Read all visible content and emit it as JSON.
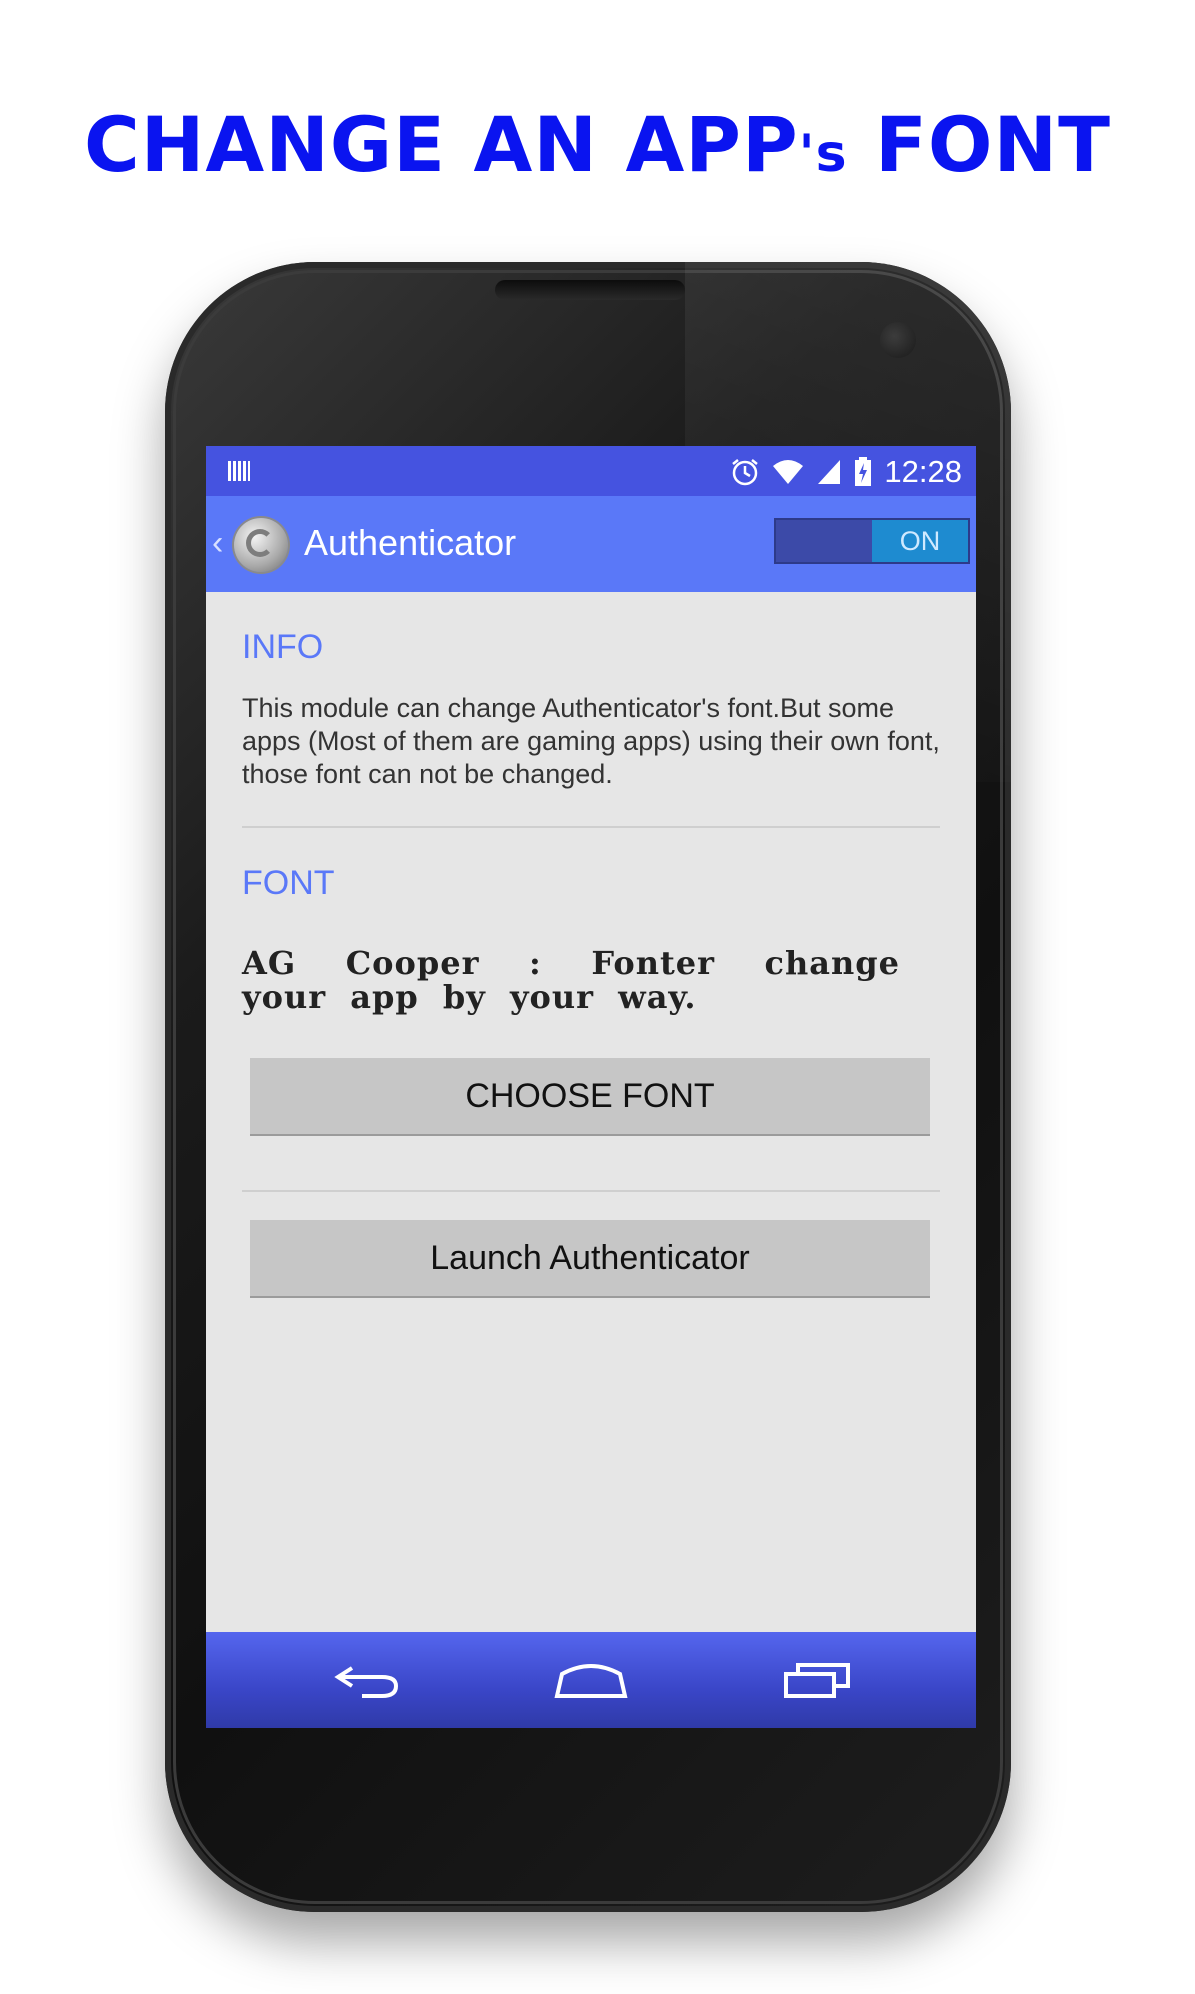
{
  "headline": {
    "part1": "CHANGE AN APP",
    "part2": "'s",
    "part3": " FONT"
  },
  "status_bar": {
    "time": "12:28",
    "icons": [
      "notification-icon",
      "alarm-icon",
      "wifi-icon",
      "signal-icon",
      "battery-charging-icon"
    ]
  },
  "action_bar": {
    "back_icon": "chevron-left-icon",
    "app_icon": "authenticator-app-icon",
    "title": "Authenticator",
    "toggle_label": "ON",
    "toggle_state": "on"
  },
  "info": {
    "heading": "INFO",
    "text": "This module can change  Authenticator's font.But some apps (Most of them are gaming apps) using their own font, those font can not be changed."
  },
  "font": {
    "heading": "FONT",
    "sample": "AG Cooper : Fonter change your app by your way.",
    "choose_button": "CHOOSE FONT"
  },
  "launch_button": "Launch Authenticator",
  "nav_bar": {
    "icons": [
      "back-icon",
      "home-icon",
      "recents-icon"
    ]
  },
  "colors": {
    "headline": "#0a14f0",
    "status_bar": "#4553e0",
    "action_bar": "#5a78f8",
    "section_heading": "#5a78f8",
    "toggle_on": "#1e8bd0"
  }
}
